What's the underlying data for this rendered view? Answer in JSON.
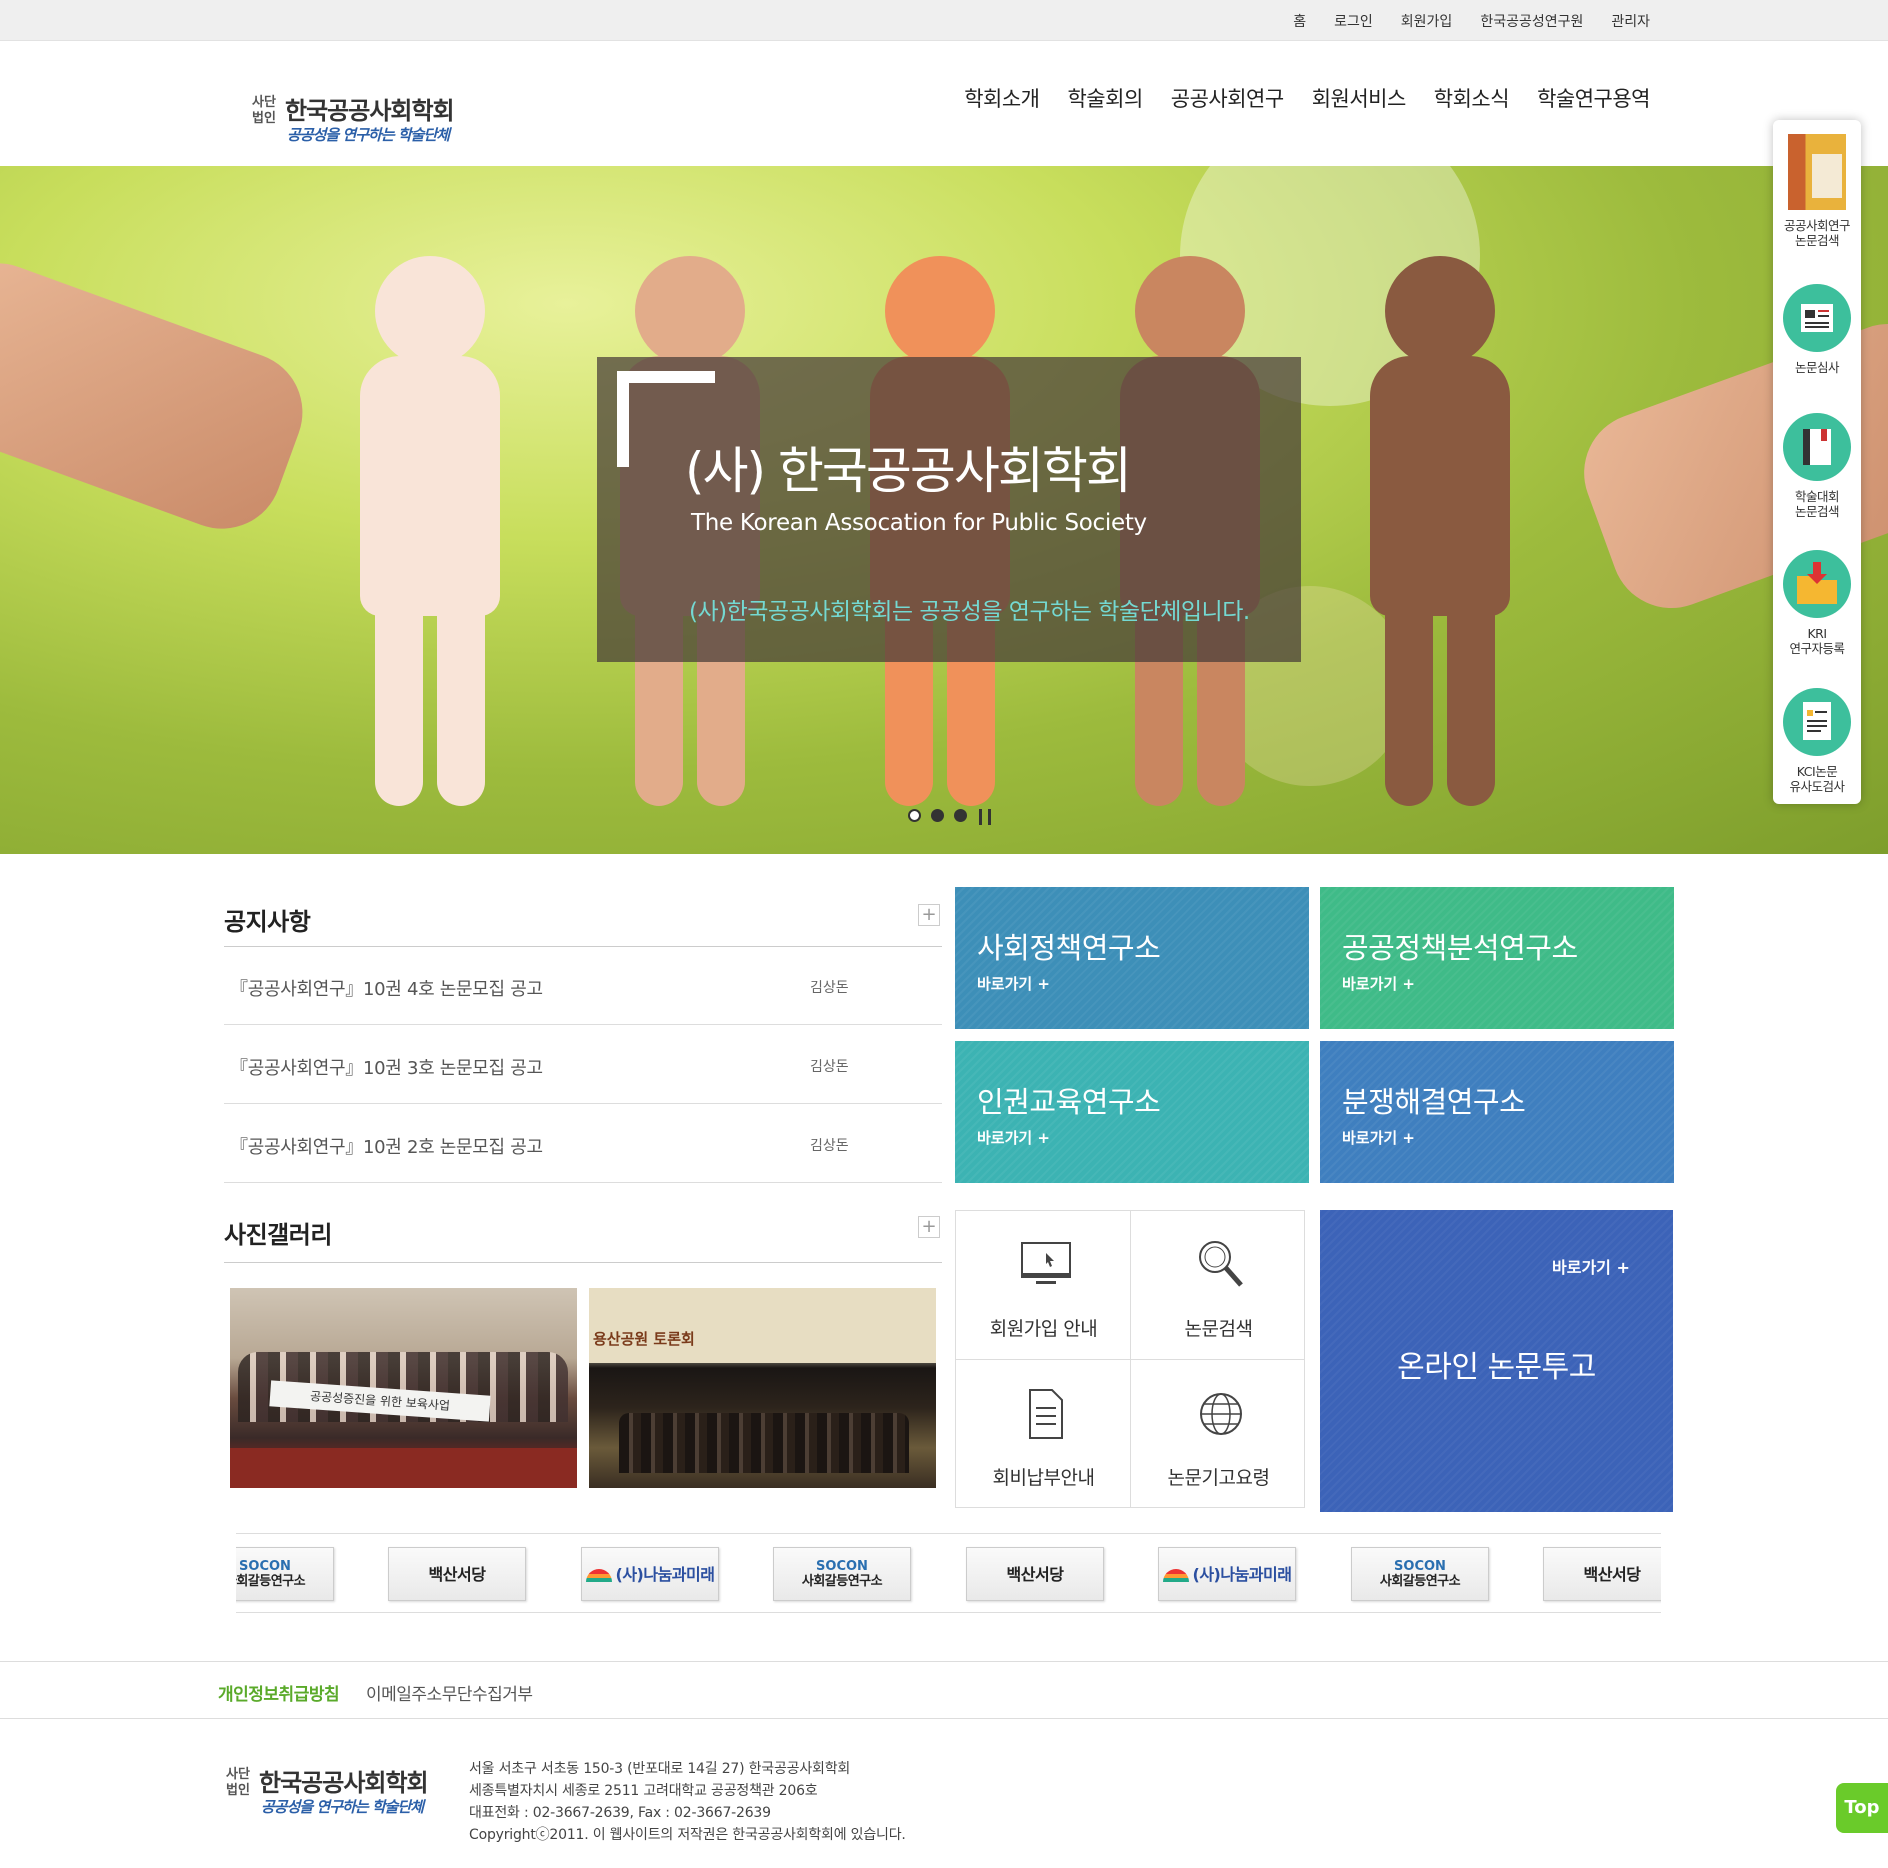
{
  "topbar": {
    "links": [
      "홈",
      "로그인",
      "회원가입",
      "한국공공성연구원",
      "관리자"
    ]
  },
  "logo": {
    "small": "사단법인",
    "name": "한국공공사회학회",
    "sub": "공공성을 연구하는 학술단체"
  },
  "gnb": [
    "학회소개",
    "학술회의",
    "공공사회연구",
    "회원서비스",
    "학회소식",
    "학술연구용역"
  ],
  "hero": {
    "title": "(사) 한국공공사회학회",
    "english": "The Korean Assocation for Public Society",
    "desc": "(사)한국공공사회학회는 공공성을 연구하는 학술단체입니다."
  },
  "quick_menu": [
    {
      "label1": "공공사회연구",
      "label2": "논문검색"
    },
    {
      "label1": "논문심사",
      "label2": ""
    },
    {
      "label1": "학술대회",
      "label2": "논문검색"
    },
    {
      "label1": "KRI",
      "label2": "연구자등록"
    },
    {
      "label1": "KCI논문",
      "label2": "유사도검사"
    }
  ],
  "notice": {
    "title": "공지사항",
    "plus": "+",
    "items": [
      {
        "title": "『공공사회연구』10권 4호 논문모집 공고",
        "author": "김상돈"
      },
      {
        "title": "『공공사회연구』10권 3호 논문모집 공고",
        "author": "김상돈"
      },
      {
        "title": "『공공사회연구』10권 2호 논문모집 공고",
        "author": "김상돈"
      }
    ]
  },
  "institutes": [
    {
      "title": "사회정책연구소",
      "go": "바로가기 +",
      "color": "#3d8fb8"
    },
    {
      "title": "공공정책분석연구소",
      "go": "바로가기 +",
      "color": "#3fbb88"
    },
    {
      "title": "인권교육연구소",
      "go": "바로가기 +",
      "color": "#3cb3b3"
    },
    {
      "title": "분쟁해결연구소",
      "go": "바로가기 +",
      "color": "#3f7fbf"
    }
  ],
  "gallery": {
    "title": "사진갤러리",
    "plus": "+",
    "photo1_banner": "공공성증진을 위한 보육사업",
    "photo2_caption": "용산공원 토론회"
  },
  "quick_links": [
    {
      "label": "회원가입 안내",
      "icon": "monitor-icon"
    },
    {
      "label": "논문검색",
      "icon": "search-icon"
    },
    {
      "label": "회비납부안내",
      "icon": "document-icon"
    },
    {
      "label": "논문기고요령",
      "icon": "globe-icon"
    }
  ],
  "submit": {
    "go": "바로가기 +",
    "title": "온라인 논문투고"
  },
  "banners": {
    "baeksan": "백산서당",
    "socon_top": "SOCON",
    "socon_bottom": "사회갈등연구소",
    "nanum": "(사)나눔과미래"
  },
  "footer": {
    "privacy": "개인정보취급방침",
    "email": "이메일주소무단수집거부",
    "addr1": "서울 서초구 서초동 150-3 (반포대로 14길 27) 한국공공사회학회",
    "addr2": "세종특별자치시 세종로 2511 고려대학교 공공정책관 206호",
    "phone": "대표전화 : 02-3667-2639, Fax : 02-3667-2639",
    "copyright": "Copyrightⓒ2011. 이 웹사이트의 저작권은 한국공공사회학회에 있습니다.",
    "top": "Top"
  }
}
